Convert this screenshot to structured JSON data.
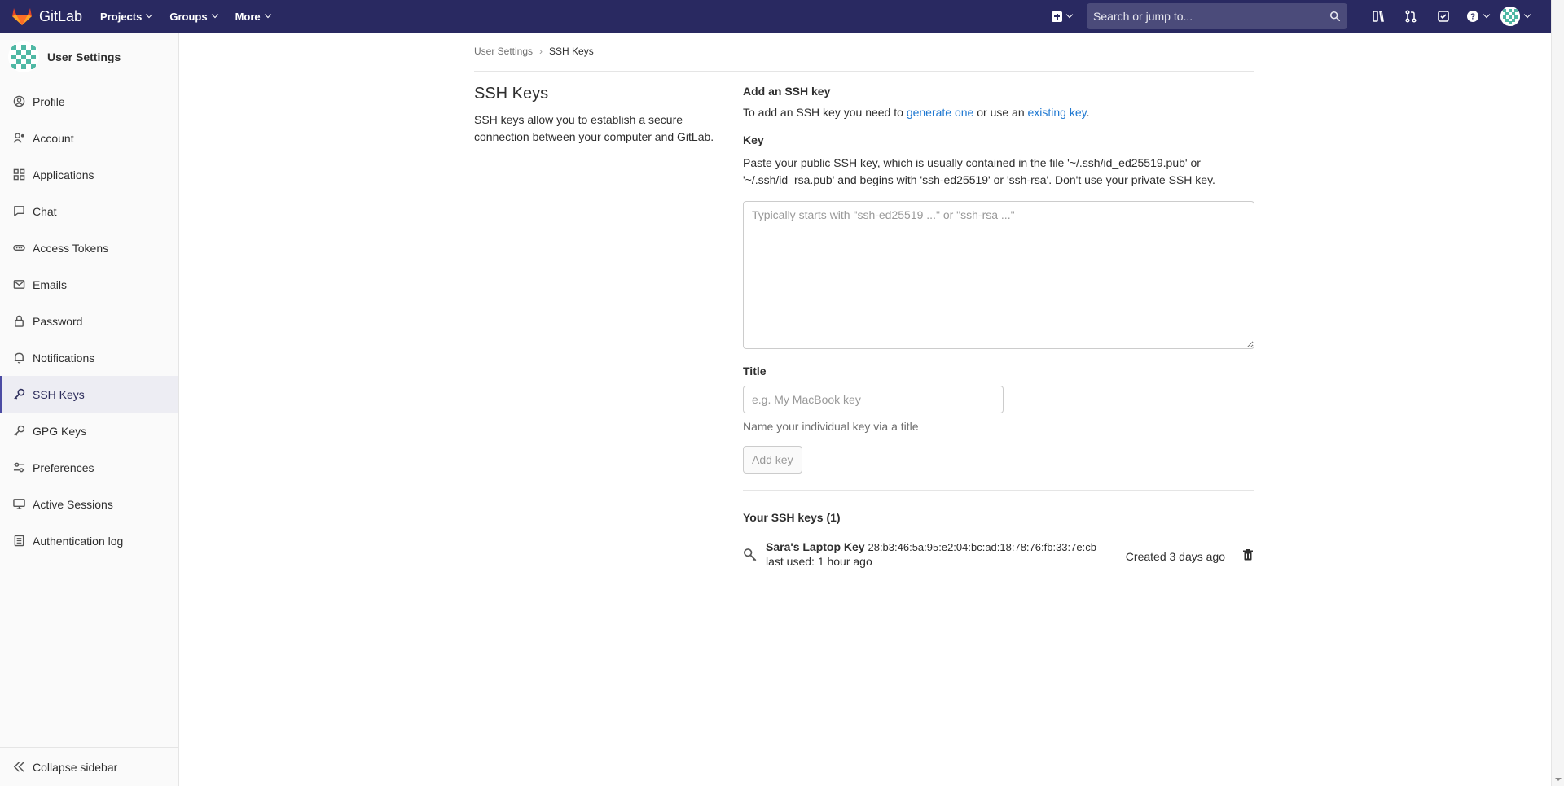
{
  "navbar": {
    "brand": "GitLab",
    "menu": [
      {
        "label": "Projects"
      },
      {
        "label": "Groups"
      },
      {
        "label": "More"
      }
    ],
    "search_placeholder": "Search or jump to...",
    "brand_color": "#292961"
  },
  "sidebar": {
    "title": "User Settings",
    "items": [
      {
        "label": "Profile",
        "icon": "profile-icon"
      },
      {
        "label": "Account",
        "icon": "account-icon"
      },
      {
        "label": "Applications",
        "icon": "applications-icon"
      },
      {
        "label": "Chat",
        "icon": "chat-icon"
      },
      {
        "label": "Access Tokens",
        "icon": "token-icon"
      },
      {
        "label": "Emails",
        "icon": "mail-icon"
      },
      {
        "label": "Password",
        "icon": "lock-icon"
      },
      {
        "label": "Notifications",
        "icon": "bell-icon"
      },
      {
        "label": "SSH Keys",
        "icon": "key-icon",
        "active": true
      },
      {
        "label": "GPG Keys",
        "icon": "key-icon"
      },
      {
        "label": "Preferences",
        "icon": "preferences-icon"
      },
      {
        "label": "Active Sessions",
        "icon": "monitor-icon"
      },
      {
        "label": "Authentication log",
        "icon": "log-icon"
      }
    ],
    "collapse_label": "Collapse sidebar"
  },
  "breadcrumb": {
    "parent": "User Settings",
    "current": "SSH Keys"
  },
  "intro": {
    "title": "SSH Keys",
    "description": "SSH keys allow you to establish a secure connection between your computer and GitLab."
  },
  "form": {
    "heading": "Add an SSH key",
    "intro_prefix": "To add an SSH key you need to ",
    "intro_link1": "generate one",
    "intro_middle": " or use an ",
    "intro_link2": "existing key",
    "intro_suffix": ".",
    "key_label": "Key",
    "key_help": "Paste your public SSH key, which is usually contained in the file '~/.ssh/id_ed25519.pub' or '~/.ssh/id_rsa.pub' and begins with 'ssh-ed25519' or 'ssh-rsa'. Don't use your private SSH key.",
    "key_placeholder": "Typically starts with \"ssh-ed25519 ...\" or \"ssh-rsa ...\"",
    "title_label": "Title",
    "title_placeholder": "e.g. My MacBook key",
    "title_help": "Name your individual key via a title",
    "submit_label": "Add key"
  },
  "keys": {
    "heading": "Your SSH keys (1)",
    "items": [
      {
        "title": "Sara's Laptop Key",
        "fingerprint": "28:b3:46:5a:95:e2:04:bc:ad:18:78:76:fb:33:7e:cb",
        "last_used": "last used: 1 hour ago",
        "created": "Created 3 days ago"
      }
    ]
  },
  "colors": {
    "link": "#1f78d1",
    "active_accent": "#4b4ba3"
  }
}
